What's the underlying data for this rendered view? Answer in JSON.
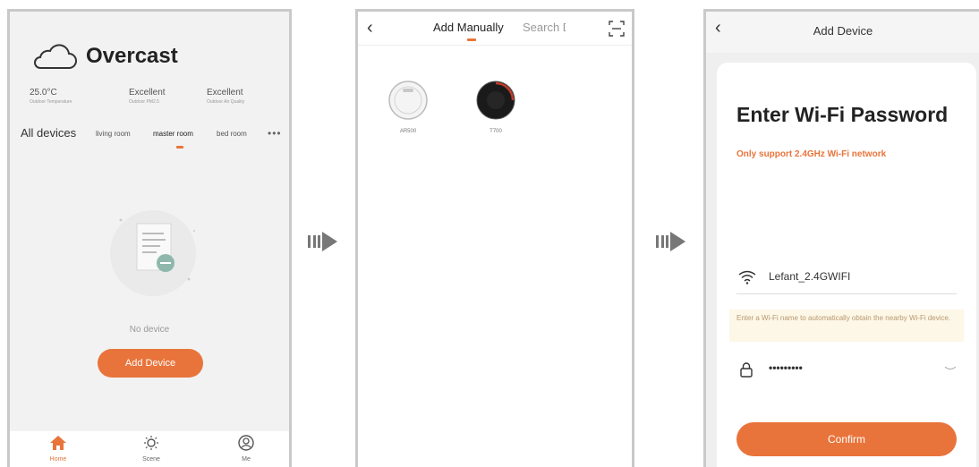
{
  "home": {
    "weather": {
      "condition": "Overcast",
      "icon": "cloud-icon"
    },
    "stats": [
      {
        "value": "25.0°C",
        "label": "Outdoor Temperature"
      },
      {
        "value": "Excellent",
        "label": "Outdoor PM2.5"
      },
      {
        "value": "Excellent",
        "label": "Outdoor Air Quality"
      }
    ],
    "tabs": {
      "all": "All devices",
      "rooms": [
        "living room",
        "master room",
        "bed room"
      ],
      "more": "•••"
    },
    "empty_text": "No device",
    "add_button": "Add Device",
    "nav": [
      {
        "label": "Home",
        "icon": "home-icon"
      },
      {
        "label": "Scene",
        "icon": "sun-icon"
      },
      {
        "label": "Me",
        "icon": "profile-icon"
      }
    ]
  },
  "add_manually": {
    "tab_manual": "Add Manually",
    "tab_search": "Search Device",
    "devices": [
      {
        "name": "AR500",
        "icon": "robot-vacuum-white-icon"
      },
      {
        "name": "T700",
        "icon": "robot-vacuum-black-icon"
      }
    ]
  },
  "wifi": {
    "header_title": "Add Device",
    "title": "Enter Wi-Fi Password",
    "note": "Only support 2.4GHz Wi-Fi network",
    "ssid": "Lefant_2.4GWIFI",
    "hint": "Enter a Wi-Fi name to automatically obtain the nearby Wi-Fi device.",
    "password_mask": "•••••••••",
    "confirm": "Confirm"
  },
  "colors": {
    "accent": "#e8743b",
    "frame": "#c9c9c9"
  }
}
